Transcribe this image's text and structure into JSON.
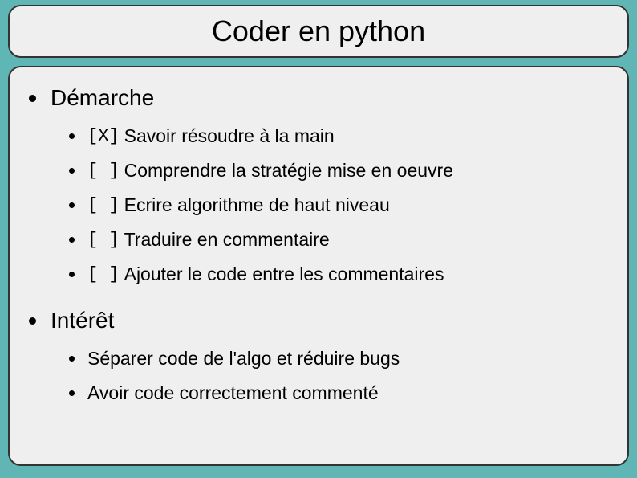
{
  "title": "Coder en python",
  "sections": [
    {
      "heading": "Démarche",
      "items": [
        {
          "check": "[X]",
          "text": "Savoir résoudre à la main"
        },
        {
          "check": "[ ]",
          "text": "Comprendre la stratégie mise en oeuvre"
        },
        {
          "check": "[ ]",
          "text": "Ecrire algorithme de haut niveau"
        },
        {
          "check": "[ ]",
          "text": "Traduire en commentaire"
        },
        {
          "check": "[ ]",
          "text": "Ajouter le code entre les commentaires"
        }
      ]
    },
    {
      "heading": "Intérêt",
      "items": [
        {
          "text": "Séparer code de l'algo et réduire bugs"
        },
        {
          "text": "Avoir code correctement commenté"
        }
      ]
    }
  ]
}
